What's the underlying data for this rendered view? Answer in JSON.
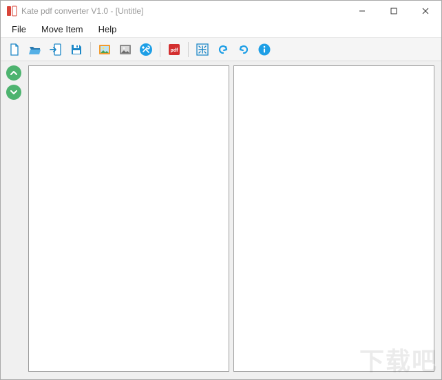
{
  "window": {
    "title": "Kate pdf converter V1.0 - [Untitle]"
  },
  "menu": {
    "items": [
      "File",
      "Move Item",
      "Help"
    ]
  },
  "toolbar": {
    "icons": [
      "new",
      "open",
      "import",
      "save",
      "image-color",
      "image-gray",
      "settings",
      "pdf",
      "fit-screen",
      "undo",
      "redo",
      "info"
    ]
  },
  "siderail": {
    "up_label": "up",
    "down_label": "down"
  },
  "watermark": "下载吧"
}
